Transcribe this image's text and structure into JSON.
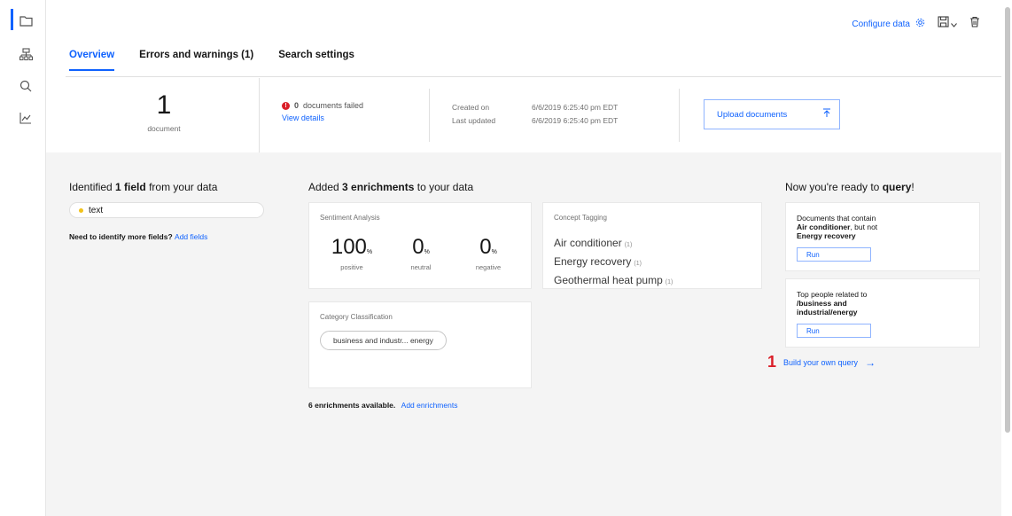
{
  "toolbar": {
    "configure_label": "Configure data"
  },
  "tabs": [
    {
      "label": "Overview"
    },
    {
      "label": "Errors and warnings (1)"
    },
    {
      "label": "Search settings"
    }
  ],
  "summary": {
    "doc_count": "1",
    "doc_label": "document",
    "failed_count": "0",
    "failed_text": "documents failed",
    "view_details": "View details",
    "created_label": "Created on",
    "created_value": "6/6/2019 6:25:40 pm EDT",
    "updated_label": "Last updated",
    "updated_value": "6/6/2019 6:25:40 pm EDT",
    "upload_label": "Upload documents"
  },
  "fields": {
    "heading_pre": "Identified ",
    "heading_bold": "1 field",
    "heading_post": " from your data",
    "items": [
      "text"
    ],
    "more_text": "Need to identify more fields?",
    "add_link": "Add fields"
  },
  "enrichments": {
    "heading_pre": "Added ",
    "heading_bold": "3 enrichments",
    "heading_post": " to your data",
    "sentiment": {
      "title": "Sentiment Analysis",
      "items": [
        {
          "value": "100",
          "unit": "%",
          "label": "positive"
        },
        {
          "value": "0",
          "unit": "%",
          "label": "neutral"
        },
        {
          "value": "0",
          "unit": "%",
          "label": "negative"
        }
      ]
    },
    "concept": {
      "title": "Concept Tagging",
      "items": [
        {
          "label": "Air conditioner",
          "count": "(1)"
        },
        {
          "label": "Energy recovery",
          "count": "(1)"
        },
        {
          "label": "Geothermal heat pump",
          "count": "(1)"
        }
      ]
    },
    "category": {
      "title": "Category Classification",
      "tag": "business and industr... energy"
    },
    "available_text": "6 enrichments available.",
    "add_link": "Add enrichments"
  },
  "query": {
    "heading_pre": "Now you're ready to ",
    "heading_bold": "query",
    "heading_post": "!",
    "card1": {
      "l1": "Documents that contain",
      "l2_bold": "Air conditioner",
      "l2_rest": ", but not",
      "l3_bold": "Energy recovery",
      "run": "Run"
    },
    "card2": {
      "l1": "Top people related to",
      "l2_bold": "/business and",
      "l3_bold": "industrial/energy",
      "run": "Run"
    },
    "callout_num": "1",
    "build_label": "Build your own query",
    "build_arrow": "→"
  },
  "icons": [
    "folder-icon",
    "structure-icon",
    "search-icon",
    "chart-icon",
    "gear-icon",
    "save-icon",
    "delete-icon",
    "upload-icon"
  ]
}
